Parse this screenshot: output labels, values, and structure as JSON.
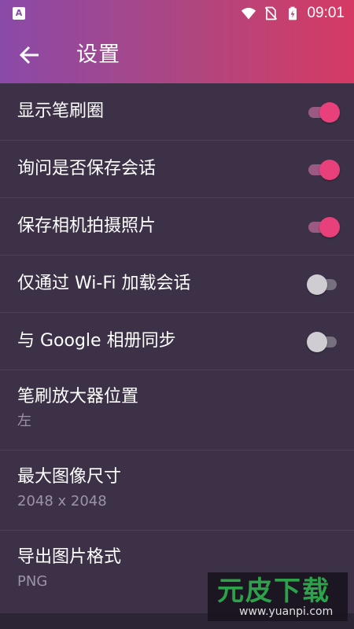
{
  "status_bar": {
    "left_icon_letter": "A",
    "time": "09:01",
    "icons": [
      "wifi-icon",
      "no-sim-icon",
      "battery-charging-icon"
    ]
  },
  "header": {
    "title": "设置",
    "back_icon": "arrow-back-icon",
    "gradient_colors": [
      "#8a4aa8",
      "#d63a63"
    ]
  },
  "settings": {
    "show_brush_ring": {
      "label": "显示笔刷圈",
      "enabled": true
    },
    "ask_save_session": {
      "label": "询问是否保存会话",
      "enabled": true
    },
    "save_camera_photos": {
      "label": "保存相机拍摄照片",
      "enabled": true
    },
    "wifi_only_load": {
      "label": "仅通过 Wi-Fi 加载会话",
      "enabled": false
    },
    "google_sync": {
      "label": "与 Google 相册同步",
      "enabled": false
    },
    "brush_magnifier": {
      "label": "笔刷放大器位置",
      "value": "左"
    },
    "max_image_size": {
      "label": "最大图像尺寸",
      "value": "2048 x 2048"
    },
    "export_format": {
      "label": "导出图片格式",
      "value": "PNG"
    }
  },
  "watermark": {
    "text": "元皮下载",
    "url": "www.yuanpi.com"
  },
  "colors": {
    "background": "#3c3147",
    "toggle_on": "#e8407a",
    "toggle_off": "#cfcdd2",
    "subtext": "#9d93a8"
  }
}
